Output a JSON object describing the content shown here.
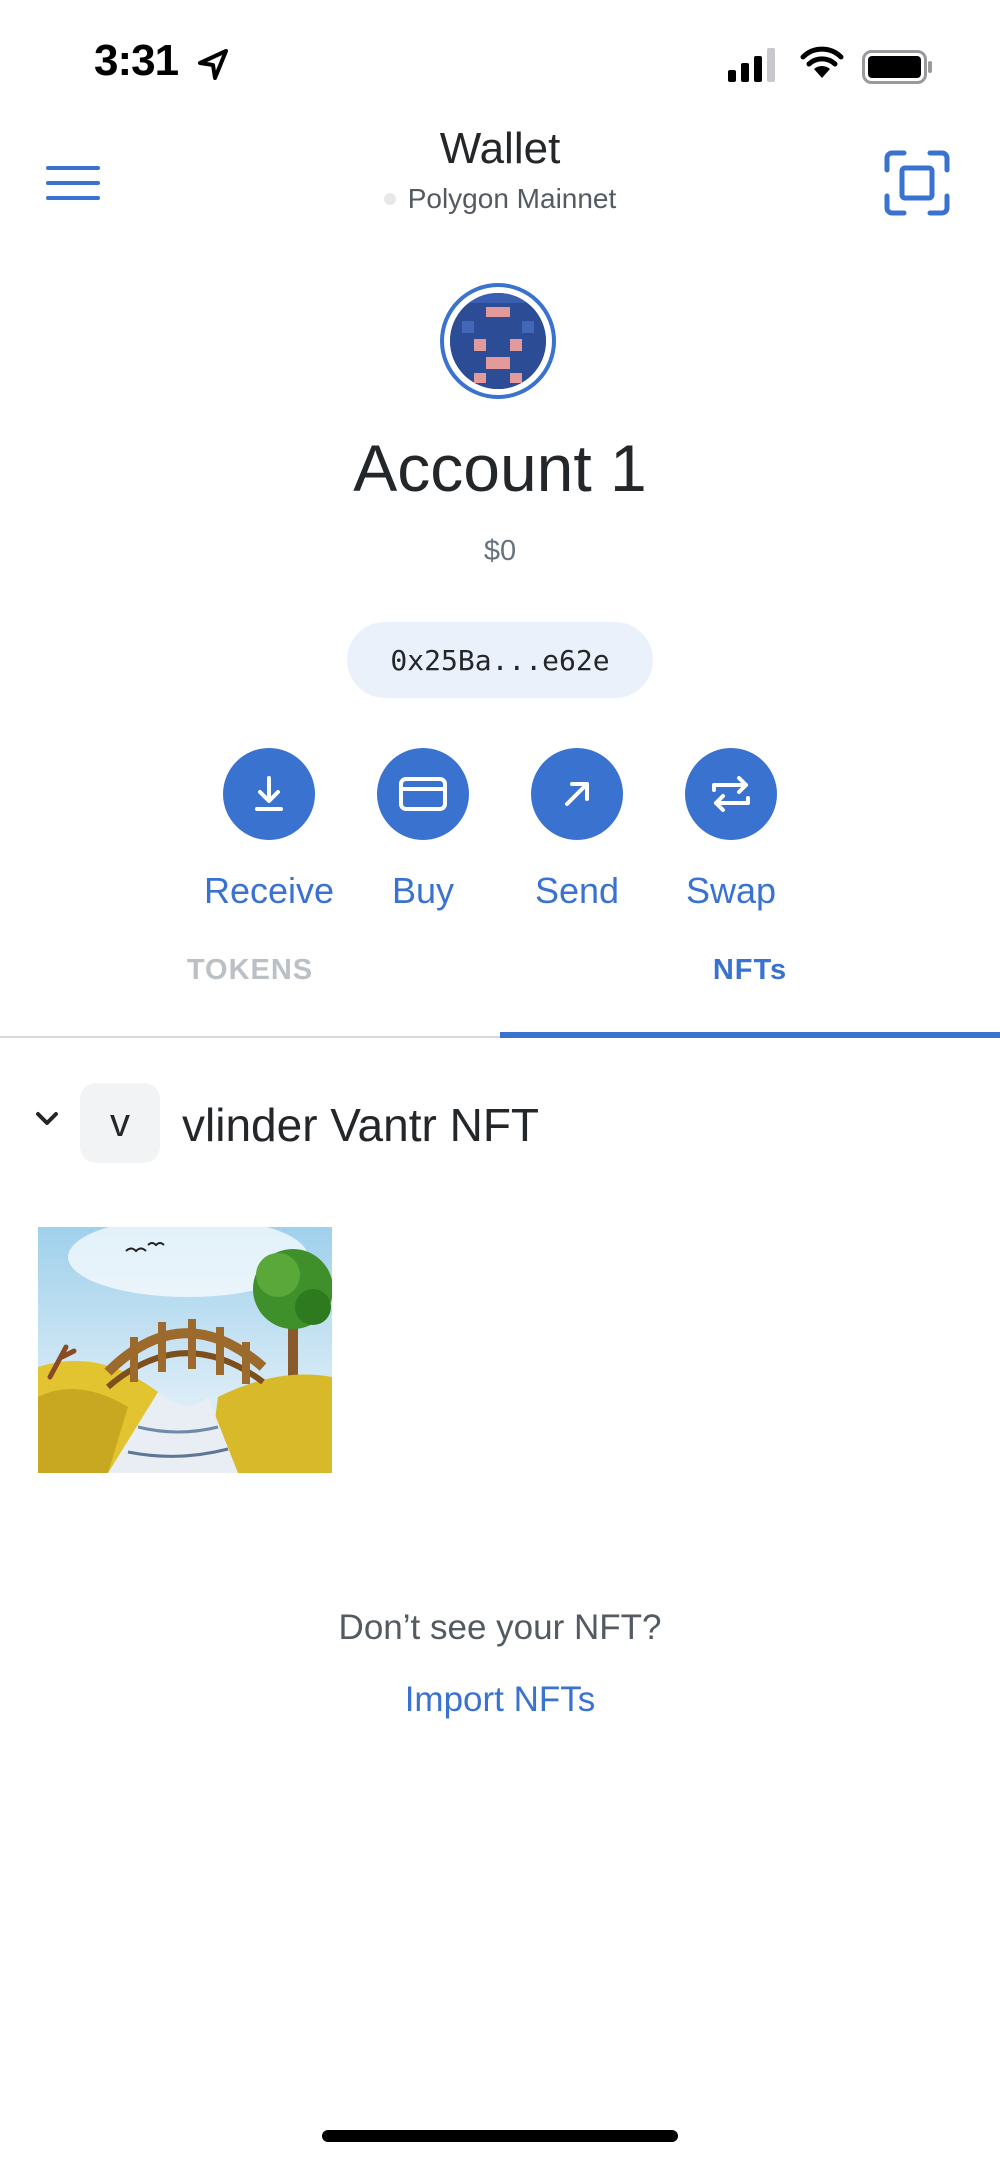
{
  "status_bar": {
    "time": "3:31"
  },
  "header": {
    "title": "Wallet",
    "network": "Polygon Mainnet"
  },
  "account": {
    "name": "Account 1",
    "balance": "$0",
    "address": "0x25Ba...e62e"
  },
  "actions": [
    {
      "label": "Receive",
      "icon": "download-icon"
    },
    {
      "label": "Buy",
      "icon": "card-icon"
    },
    {
      "label": "Send",
      "icon": "arrow-up-right-icon"
    },
    {
      "label": "Swap",
      "icon": "swap-arrows-icon"
    }
  ],
  "tabs": {
    "tokens": "TOKENS",
    "nfts": "NFTs",
    "active": "NFTs"
  },
  "collection": {
    "badge_letter": "v",
    "name": "vlinder Vantr NFT"
  },
  "footer": {
    "prompt": "Don’t see your NFT?",
    "import_link": "Import NFTs"
  },
  "colors": {
    "accent": "#3a72cf",
    "text_primary": "#24272a",
    "text_muted": "#6a737d",
    "pill_bg": "#eaf1fa",
    "inactive_tab": "#bbc0c5"
  }
}
